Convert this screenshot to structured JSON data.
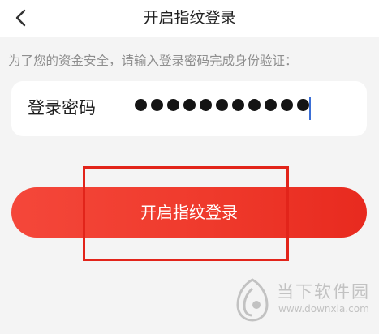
{
  "header": {
    "title": "开启指纹登录",
    "back_icon": "chevron-left-icon"
  },
  "hint": "为了您的资金安全，请输入登录密码完成身份验证：",
  "password_field": {
    "label": "登录密码",
    "value": "●●●●●●●●●●●",
    "masked_length": 11
  },
  "submit_button": {
    "label": "开启指纹登录"
  },
  "watermark": {
    "title": "当下软件园",
    "url": "www.downxia.com"
  },
  "colors": {
    "accent": "#ef3a2c",
    "highlight_box": "#e2241a",
    "caret": "#3b6fd6",
    "background": "#f4f4f4"
  }
}
